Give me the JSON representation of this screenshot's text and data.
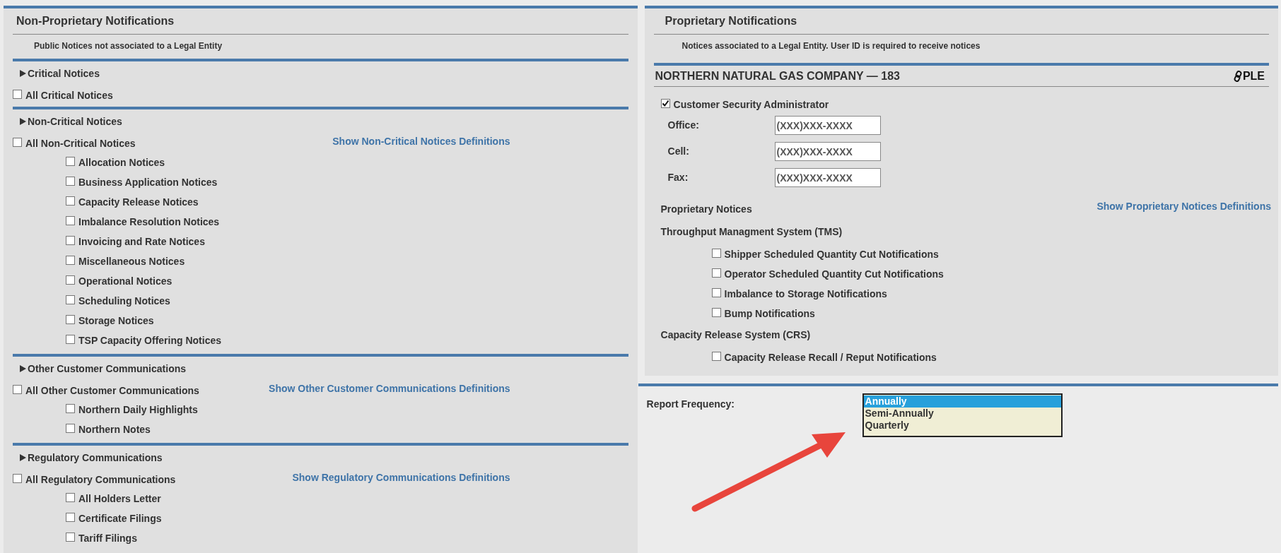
{
  "non_proprietary": {
    "title": "Non-Proprietary Notifications",
    "subtitle": "Public Notices not associated to a Legal Entity",
    "sections": [
      {
        "header": "Critical Notices",
        "all": {
          "label": "All Critical Notices",
          "checked": false
        }
      },
      {
        "header": "Non-Critical Notices",
        "all": {
          "label": "All Non-Critical Notices",
          "checked": false
        },
        "definitions_link": "Show Non-Critical Notices Definitions",
        "items": [
          {
            "label": "Allocation Notices",
            "checked": false
          },
          {
            "label": "Business Application Notices",
            "checked": false
          },
          {
            "label": "Capacity Release Notices",
            "checked": false
          },
          {
            "label": "Imbalance Resolution Notices",
            "checked": false
          },
          {
            "label": "Invoicing and Rate Notices",
            "checked": false
          },
          {
            "label": "Miscellaneous Notices",
            "checked": false
          },
          {
            "label": "Operational Notices",
            "checked": false
          },
          {
            "label": "Scheduling Notices",
            "checked": false
          },
          {
            "label": "Storage Notices",
            "checked": false
          },
          {
            "label": "TSP Capacity Offering Notices",
            "checked": false
          }
        ]
      },
      {
        "header": "Other Customer Communications",
        "all": {
          "label": "All Other Customer Communications",
          "checked": false
        },
        "definitions_link": "Show Other Customer Communications Definitions",
        "items": [
          {
            "label": "Northern Daily Highlights",
            "checked": false
          },
          {
            "label": "Northern Notes",
            "checked": false
          }
        ]
      },
      {
        "header": "Regulatory Communications",
        "all": {
          "label": "All Regulatory Communications",
          "checked": false
        },
        "definitions_link": "Show Regulatory Communications Definitions",
        "items": [
          {
            "label": "All Holders Letter",
            "checked": false
          },
          {
            "label": "Certificate Filings",
            "checked": false
          },
          {
            "label": "Tariff Filings",
            "checked": false
          }
        ]
      }
    ]
  },
  "proprietary": {
    "title": "Proprietary Notifications",
    "subtitle": "Notices associated to a Legal Entity. User ID is required to receive notices",
    "company": "NORTHERN NATURAL GAS COMPANY — 183",
    "company_link": "PLE",
    "admin": {
      "label": "Customer Security Administrator",
      "checked": true
    },
    "phones": [
      {
        "label": "Office:",
        "value": "(XXX)XXX-XXXX"
      },
      {
        "label": "Cell:",
        "value": "(XXX)XXX-XXXX"
      },
      {
        "label": "Fax:",
        "value": "(XXX)XXX-XXXX"
      }
    ],
    "notices_label": "Proprietary Notices",
    "definitions_link": "Show Proprietary Notices Definitions",
    "systems": [
      {
        "title": "Throughput Managment System (TMS)",
        "items": [
          {
            "label": "Shipper Scheduled Quantity Cut Notifications",
            "checked": false
          },
          {
            "label": "Operator Scheduled Quantity Cut Notifications",
            "checked": false
          },
          {
            "label": "Imbalance to Storage Notifications",
            "checked": false
          },
          {
            "label": "Bump Notifications",
            "checked": false
          }
        ]
      },
      {
        "title": "Capacity Release System (CRS)",
        "items": [
          {
            "label": "Capacity Release Recall / Reput Notifications",
            "checked": false
          }
        ]
      }
    ]
  },
  "report_frequency": {
    "label": "Report Frequency:",
    "options": [
      {
        "label": "Annually",
        "selected": true
      },
      {
        "label": "Semi-Annually",
        "selected": false
      },
      {
        "label": "Quarterly",
        "selected": false
      }
    ]
  }
}
